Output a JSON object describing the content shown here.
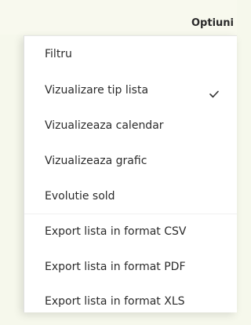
{
  "header": {
    "options_label": "Optiuni"
  },
  "menu": {
    "items": [
      {
        "label": "Filtru",
        "checked": false
      },
      {
        "label": "Vizualizare tip lista",
        "checked": true
      },
      {
        "label": "Vizualizeaza calendar",
        "checked": false
      },
      {
        "label": "Vizualizeaza grafic",
        "checked": false
      },
      {
        "label": "Evolutie sold",
        "checked": false
      },
      {
        "label": "Export lista in format CSV",
        "checked": false
      },
      {
        "label": "Export lista in format PDF",
        "checked": false
      },
      {
        "label": "Export lista in format XLS",
        "checked": false
      }
    ],
    "check_icon": "checkmark-icon"
  },
  "colors": {
    "page_background": "#f6f8ec",
    "menu_background": "#ffffff",
    "text": "#2b2b2b"
  }
}
